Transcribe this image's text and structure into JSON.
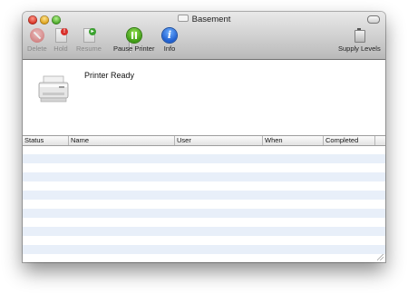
{
  "window": {
    "title": "Basement",
    "accent_color": "#e8eff9"
  },
  "toolbar": {
    "items": [
      {
        "label": "Delete",
        "icon": "delete-icon",
        "enabled": false
      },
      {
        "label": "Hold",
        "icon": "hold-icon",
        "enabled": false
      },
      {
        "label": "Resume",
        "icon": "resume-icon",
        "enabled": false
      },
      {
        "label": "Pause Printer",
        "icon": "pause-icon",
        "enabled": true
      },
      {
        "label": "Info",
        "icon": "info-icon",
        "enabled": true
      },
      {
        "label": "Supply Levels",
        "icon": "supply-levels-icon",
        "enabled": true
      }
    ]
  },
  "printer": {
    "status": "Printer Ready",
    "icon": "printer-icon"
  },
  "queue_table": {
    "columns": [
      "Status",
      "Name",
      "User",
      "When",
      "Completed"
    ],
    "rows": []
  }
}
